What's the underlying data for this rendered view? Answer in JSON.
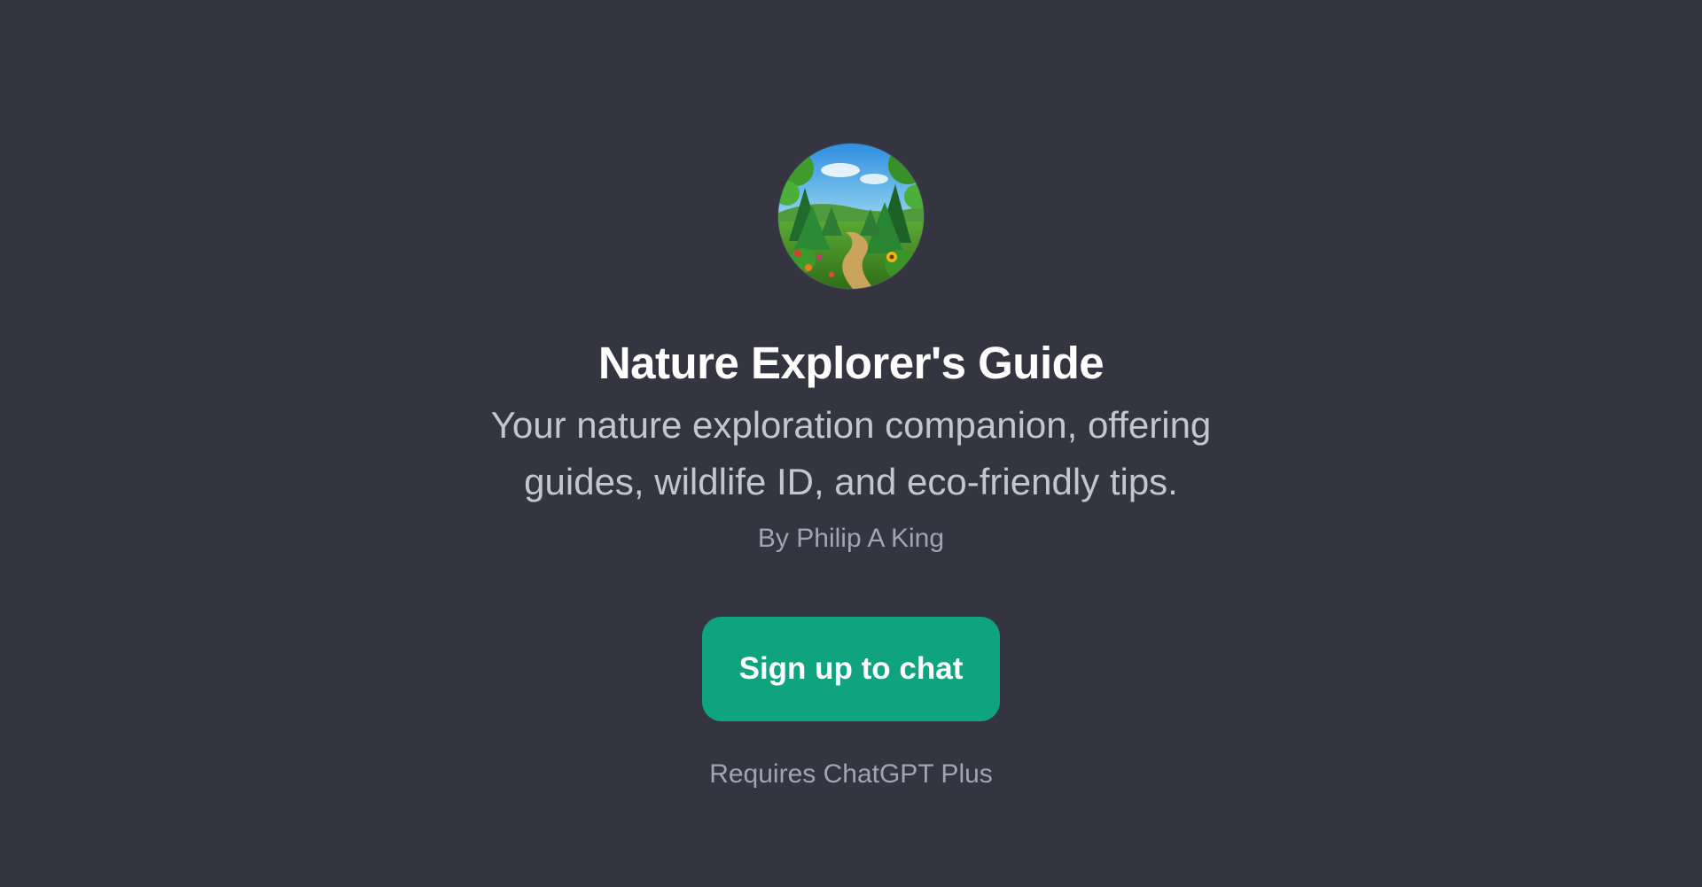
{
  "gpt": {
    "avatar_icon": "forest-trail-avatar",
    "title": "Nature Explorer's Guide",
    "description": "Your nature exploration companion, offering guides, wildlife ID, and eco-friendly tips.",
    "author": "By Philip A King"
  },
  "actions": {
    "signup_label": "Sign up to chat",
    "requirement": "Requires ChatGPT Plus"
  },
  "colors": {
    "background": "#343541",
    "accent": "#10a37f",
    "title": "#ffffff",
    "description": "#c5c5d2",
    "muted": "#a3a3b3"
  }
}
